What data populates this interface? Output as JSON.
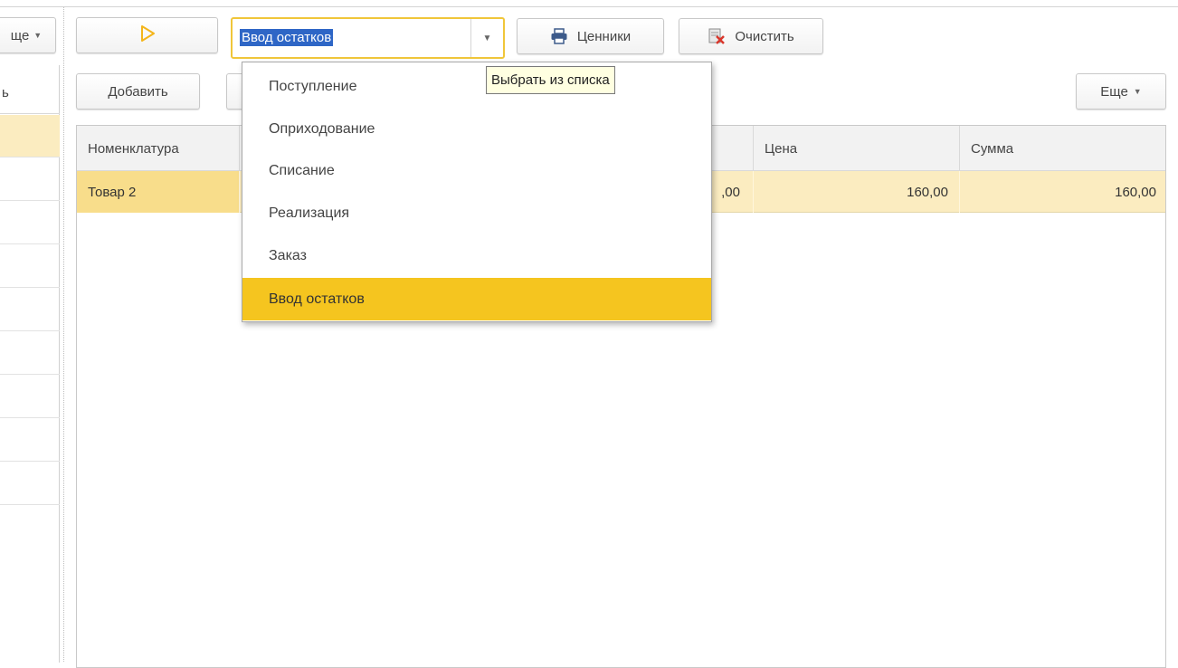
{
  "toolbar": {
    "more_left_label": "ще",
    "combo_value": "Ввод остатков",
    "price_tags_label": "Ценники",
    "clear_label": "Очистить"
  },
  "left_panel": {
    "header": "ь"
  },
  "table_toolbar": {
    "add_label": "Добавить",
    "more_label": "Еще"
  },
  "table": {
    "columns": [
      "Номенклатура",
      "Цена",
      "Сумма"
    ],
    "rows": [
      {
        "name": "Товар 2",
        "partial": ",00",
        "price": "160,00",
        "sum": "160,00"
      }
    ]
  },
  "dropdown": {
    "items": [
      "Поступление",
      "Оприходование",
      "Списание",
      "Реализация",
      "Заказ",
      "Ввод остатков"
    ],
    "selected_index": 5
  },
  "tooltip": "Выбрать из списка",
  "colors": {
    "accent": "#f5c51f",
    "row_highlight": "#fbecc0",
    "selection": "#2e66c6"
  }
}
